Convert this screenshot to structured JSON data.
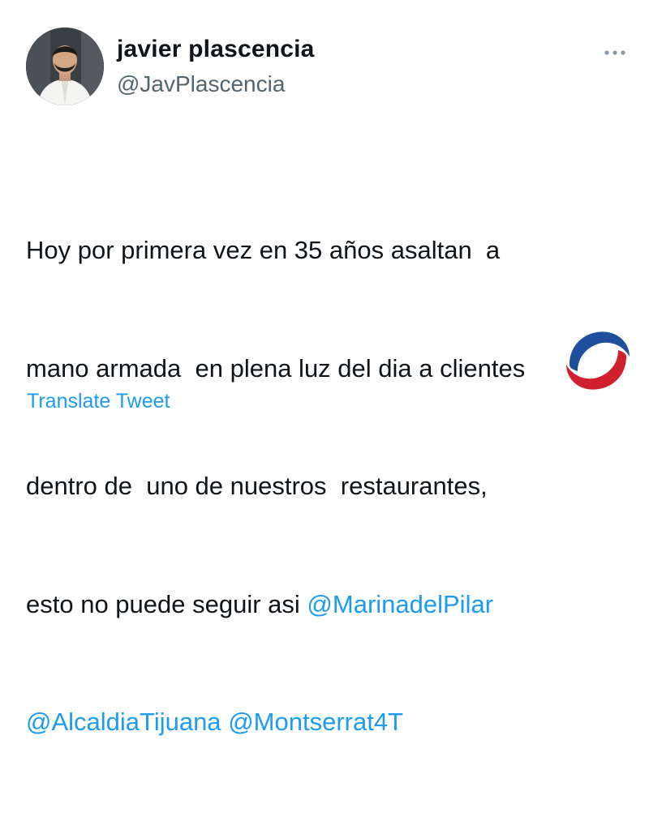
{
  "tweet": {
    "author": {
      "display_name": "javier plascencia",
      "handle": "@JavPlascencia"
    },
    "lines": [
      [
        {
          "text": "Hoy por primera vez en 35 años asaltan  a",
          "type": "text"
        }
      ],
      [
        {
          "text": "mano armada  en plena luz del dia a clientes",
          "type": "text"
        }
      ],
      [
        {
          "text": "dentro de  uno de nuestros  restaurantes,",
          "type": "text"
        }
      ],
      [
        {
          "text": "esto no puede seguir asi ",
          "type": "text"
        },
        {
          "text": "@MarinadelPilar",
          "type": "mention"
        }
      ],
      [
        {
          "text": "@AlcaldiaTijuana",
          "type": "mention"
        },
        {
          "text": " ",
          "type": "text"
        },
        {
          "text": "@Montserrat4T",
          "type": "mention"
        }
      ]
    ],
    "translate_label": "Translate Tweet",
    "more_icon": "more-horizontal-icon"
  },
  "colors": {
    "text": "#0f1419",
    "secondary": "#536471",
    "link": "#1d9bf0",
    "logo_blue": "#1f4e9c",
    "logo_red": "#d0202e"
  }
}
